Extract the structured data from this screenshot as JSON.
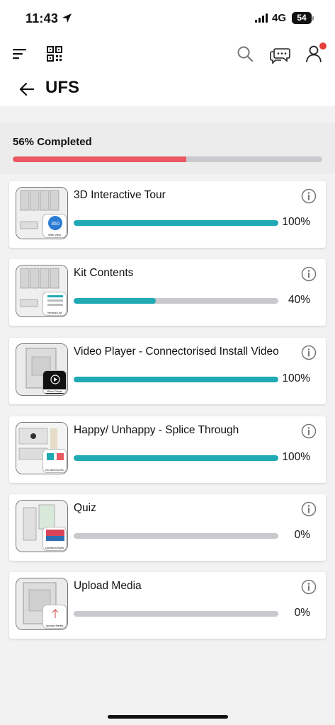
{
  "status": {
    "time": "11:43",
    "network": "4G",
    "battery": "54"
  },
  "header": {
    "title": "UFS"
  },
  "progress": {
    "label": "56% Completed",
    "value": 0.56,
    "fill_color": "#eb5763"
  },
  "colors": {
    "accent": "#20aab3",
    "track": "#c9c9ce",
    "notification": "#e5403d"
  },
  "modules": [
    {
      "title": "3D Interactive Tour",
      "percent": "100%",
      "value": 1.0,
      "thumb_label": "Web View",
      "icon": "cube-thumbnail"
    },
    {
      "title": "Kit Contents",
      "percent": "40%",
      "value": 0.4,
      "thumb_label": "Vertical List",
      "icon": "list-thumbnail"
    },
    {
      "title": "Video Player - Connectorised Install Video",
      "percent": "100%",
      "value": 1.0,
      "thumb_label": "Video Player",
      "icon": "play-thumbnail"
    },
    {
      "title": "Happy/ Unhappy - Splice Through",
      "percent": "100%",
      "value": 1.0,
      "thumb_label": "Do and Don'ts",
      "icon": "compare-thumbnail"
    },
    {
      "title": "Quiz",
      "percent": "0%",
      "value": 0.0,
      "thumb_label": "Question Bank",
      "icon": "quiz-thumbnail"
    },
    {
      "title": "Upload Media",
      "percent": "0%",
      "value": 0.0,
      "thumb_label": "Upload Media",
      "icon": "upload-thumbnail"
    }
  ]
}
